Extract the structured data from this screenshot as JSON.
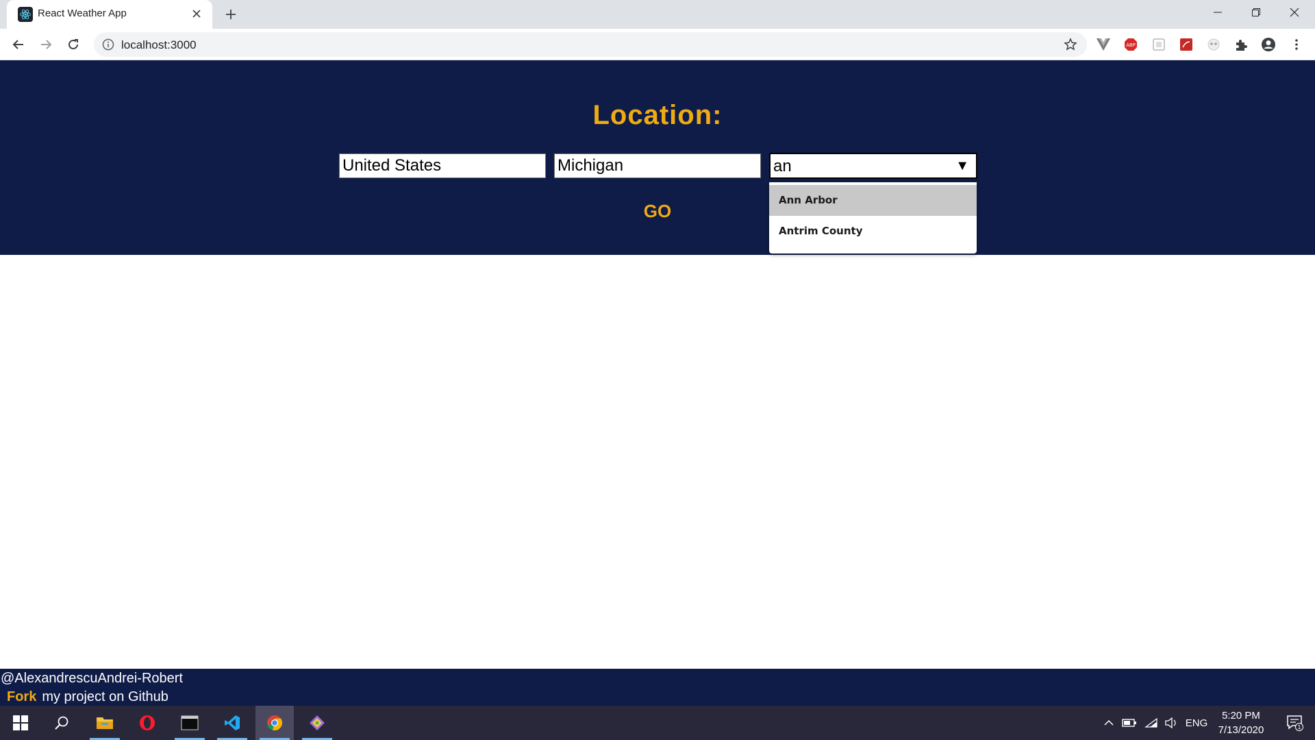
{
  "browser": {
    "tab_title": "React Weather App",
    "url": "localhost:3000"
  },
  "page": {
    "heading": "Location:",
    "country_value": "United States",
    "state_value": "Michigan",
    "city_value": "an",
    "city_options": [
      "Ann Arbor",
      "Antrim County"
    ],
    "highlighted_option": "Ann Arbor",
    "go_label": "GO"
  },
  "footer": {
    "credit": "@AlexandrescuAndrei-Robert",
    "fork_label": "Fork",
    "fork_text": "my project on Github"
  },
  "taskbar": {
    "language": "ENG",
    "time": "5:20 PM",
    "date": "7/13/2020",
    "notification_count": "1"
  },
  "colors": {
    "page_background": "#0f1c47",
    "accent": "#f0ab13"
  }
}
